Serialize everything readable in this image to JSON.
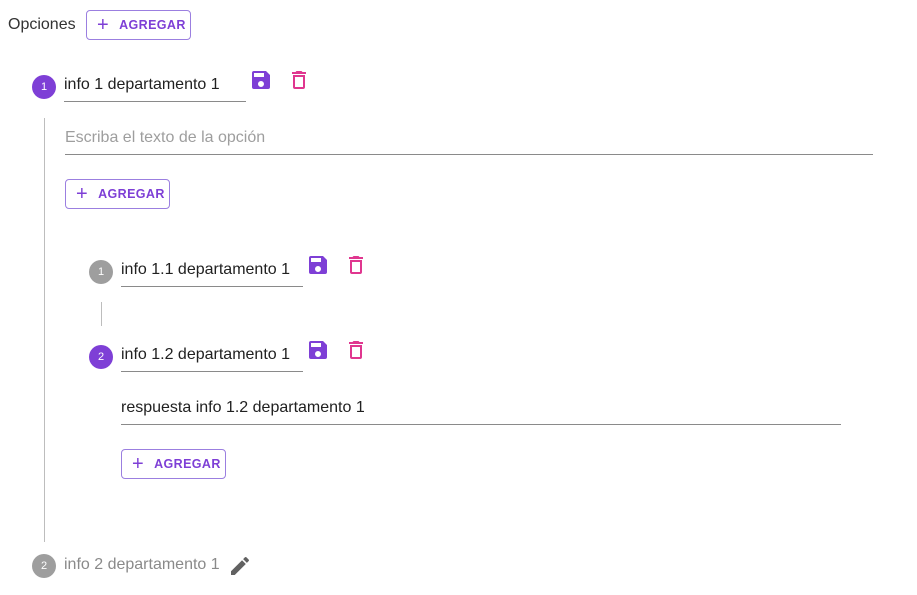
{
  "header": {
    "title": "Opciones",
    "add_label": "AGREGAR"
  },
  "option1": {
    "number": "1",
    "value": "info 1 departamento 1",
    "text_placeholder": "Escriba el texto de la opción",
    "add_label": "AGREGAR",
    "sub": [
      {
        "number": "1",
        "value": "info 1.1 departamento 1"
      },
      {
        "number": "2",
        "value": "info 1.2 departamento 1",
        "answer": "respuesta info 1.2 departamento 1",
        "add_label": "AGREGAR"
      }
    ]
  },
  "option2": {
    "number": "2",
    "value": "info 2 departamento 1"
  },
  "icons": {
    "save": "save-icon",
    "delete": "trash-icon",
    "edit": "pencil-icon",
    "add": "plus-icon"
  },
  "colors": {
    "primary": "#7e3fd6",
    "danger": "#e0368f",
    "inactive": "#9e9e9e"
  }
}
